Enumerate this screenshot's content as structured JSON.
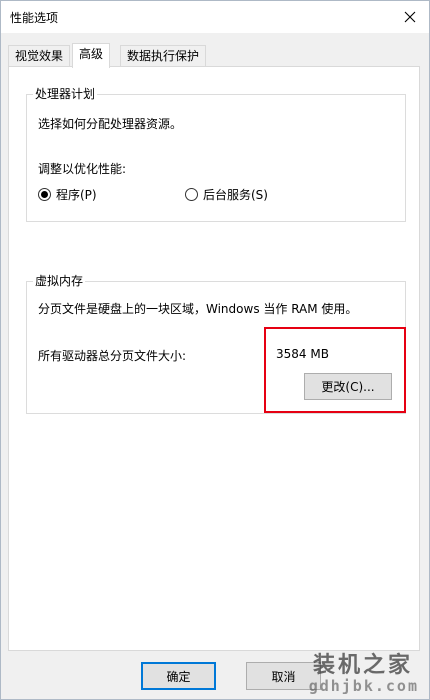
{
  "window": {
    "title": "性能选项"
  },
  "tabs": [
    {
      "label": "视觉效果",
      "active": false
    },
    {
      "label": "高级",
      "active": true
    },
    {
      "label": "数据执行保护",
      "active": false
    }
  ],
  "processor": {
    "group_label": "处理器计划",
    "description": "选择如何分配处理器资源。",
    "adjust_label": "调整以优化性能:",
    "options": [
      {
        "label": "程序(P)",
        "checked": true
      },
      {
        "label": "后台服务(S)",
        "checked": false
      }
    ]
  },
  "virtual_memory": {
    "group_label": "虚拟内存",
    "description": "分页文件是硬盘上的一块区域，Windows 当作 RAM 使用。",
    "total_label": "所有驱动器总分页文件大小:",
    "total_value": "3584 MB",
    "change_button": "更改(C)..."
  },
  "footer": {
    "ok": "确定",
    "cancel": "取消"
  },
  "watermark": {
    "main": "装机之家",
    "sub": "gdhjbk.com"
  },
  "colors": {
    "highlight": "#e60012",
    "default_button": "#0078d7"
  }
}
